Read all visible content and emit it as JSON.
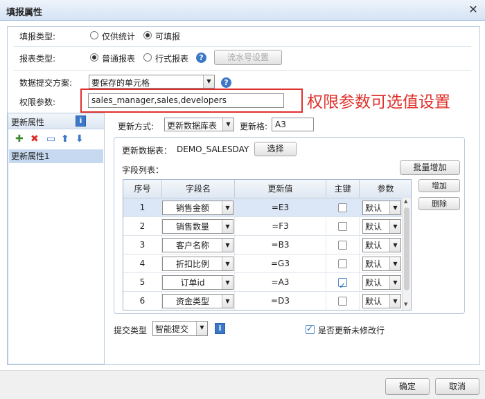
{
  "dialog": {
    "title": "填报属性",
    "close_glyph": "✕"
  },
  "fill_type": {
    "label": "填报类型:",
    "options": [
      "仅供统计",
      "可填报"
    ],
    "selected": "可填报"
  },
  "report_type": {
    "label": "报表类型:",
    "options": [
      "普通报表",
      "行式报表"
    ],
    "selected": "普通报表",
    "serial_button": "流水号设置",
    "help_glyph": "?"
  },
  "submit_scheme": {
    "label": "数据提交方案:",
    "value": "要保存的单元格",
    "help_glyph": "?"
  },
  "permission": {
    "label": "权限参数:",
    "value": "sales_manager,sales,developers"
  },
  "annotation": {
    "text": "权限参数可选值设置",
    "color": "#e0302b"
  },
  "left_panel": {
    "title": "更新属性",
    "info_glyph": "i",
    "tools": [
      {
        "name": "add-icon",
        "glyph": "✚",
        "color": "#3a8a2e"
      },
      {
        "name": "delete-icon",
        "glyph": "✖",
        "color": "#d9302b"
      },
      {
        "name": "rename-icon",
        "glyph": "▭",
        "color": "#3d78c8"
      },
      {
        "name": "arrow-up-icon",
        "glyph": "⬆",
        "color": "#3d78c8"
      },
      {
        "name": "arrow-down-icon",
        "glyph": "⬇",
        "color": "#3d78c8"
      }
    ],
    "items": [
      "更新属性1"
    ]
  },
  "update_mode": {
    "label": "更新方式:",
    "value": "更新数据库表",
    "cell_label": "更新格:",
    "cell_value": "A3"
  },
  "update_table": {
    "label": "更新数据表：",
    "value": "DEMO_SALESDAY",
    "select_button": "选择"
  },
  "field_list": {
    "label": "字段列表：",
    "batch_button": "批量增加",
    "add_button": "增加",
    "delete_button": "删除"
  },
  "grid": {
    "headers": [
      "序号",
      "字段名",
      "更新值",
      "主键",
      "参数"
    ],
    "rows": [
      {
        "no": "1",
        "field": "销售金额",
        "value": "=E3",
        "key": false,
        "param": "默认"
      },
      {
        "no": "2",
        "field": "销售数量",
        "value": "=F3",
        "key": false,
        "param": "默认"
      },
      {
        "no": "3",
        "field": "客户名称",
        "value": "=B3",
        "key": false,
        "param": "默认"
      },
      {
        "no": "4",
        "field": "折扣比例",
        "value": "=G3",
        "key": false,
        "param": "默认"
      },
      {
        "no": "5",
        "field": "订单id",
        "value": "=A3",
        "key": true,
        "param": "默认"
      },
      {
        "no": "6",
        "field": "资金类型",
        "value": "=D3",
        "key": false,
        "param": "默认"
      }
    ],
    "selected_row": 0
  },
  "submit_type": {
    "label": "提交类型",
    "value": "智能提交",
    "info_glyph": "i"
  },
  "update_unmodified": {
    "label": "是否更新未修改行",
    "checked": true
  },
  "footer": {
    "ok": "确定",
    "cancel": "取消"
  }
}
